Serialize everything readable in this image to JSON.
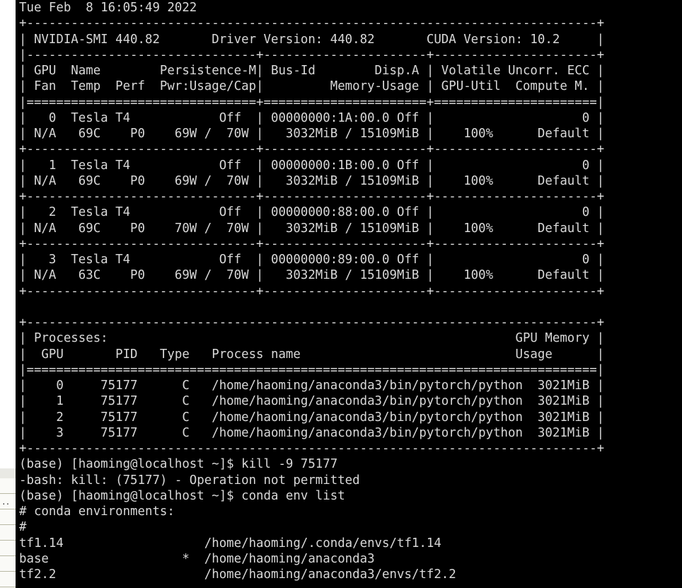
{
  "window": {
    "app": "terminal",
    "background_app": "spreadsheet",
    "bg_cell_text": ".."
  },
  "terminal": {
    "colors": {
      "background": "#000000",
      "foreground": "#d8d8d8",
      "page_background": "#ffffff"
    },
    "timestamp": "Tue Feb  8 16:05:49 2022",
    "nvidia_smi": {
      "version": "440.82",
      "driver_version": "440.82",
      "cuda_version": "10.2",
      "header_labels": {
        "smi_label": "NVIDIA-SMI",
        "driver_label": "Driver Version:",
        "cuda_label": "CUDA Version:"
      },
      "column_headers_line1": [
        "GPU",
        "Name",
        "Persistence-M",
        "Bus-Id",
        "Disp.A",
        "Volatile Uncorr. ECC"
      ],
      "column_headers_line2": [
        "Fan",
        "Temp",
        "Perf",
        "Pwr:Usage/Cap",
        "Memory-Usage",
        "GPU-Util",
        "Compute M."
      ],
      "gpus": [
        {
          "index": "0",
          "name": "Tesla T4",
          "persistence_m": "Off",
          "bus_id": "00000000:1A:00.0",
          "disp_a": "Off",
          "ecc": "0",
          "fan": "N/A",
          "temp": "69C",
          "perf": "P0",
          "pwr_usage": "69W",
          "pwr_cap": "70W",
          "mem_used": "3032MiB",
          "mem_total": "15109MiB",
          "gpu_util": "100%",
          "compute_m": "Default"
        },
        {
          "index": "1",
          "name": "Tesla T4",
          "persistence_m": "Off",
          "bus_id": "00000000:1B:00.0",
          "disp_a": "Off",
          "ecc": "0",
          "fan": "N/A",
          "temp": "69C",
          "perf": "P0",
          "pwr_usage": "69W",
          "pwr_cap": "70W",
          "mem_used": "3032MiB",
          "mem_total": "15109MiB",
          "gpu_util": "100%",
          "compute_m": "Default"
        },
        {
          "index": "2",
          "name": "Tesla T4",
          "persistence_m": "Off",
          "bus_id": "00000000:88:00.0",
          "disp_a": "Off",
          "ecc": "0",
          "fan": "N/A",
          "temp": "69C",
          "perf": "P0",
          "pwr_usage": "70W",
          "pwr_cap": "70W",
          "mem_used": "3032MiB",
          "mem_total": "15109MiB",
          "gpu_util": "100%",
          "compute_m": "Default"
        },
        {
          "index": "3",
          "name": "Tesla T4",
          "persistence_m": "Off",
          "bus_id": "00000000:89:00.0",
          "disp_a": "Off",
          "ecc": "0",
          "fan": "N/A",
          "temp": "63C",
          "perf": "P0",
          "pwr_usage": "69W",
          "pwr_cap": "70W",
          "mem_used": "3032MiB",
          "mem_total": "15109MiB",
          "gpu_util": "100%",
          "compute_m": "Default"
        }
      ],
      "processes_section": {
        "title": "Processes:",
        "column_headers": [
          "GPU",
          "PID",
          "Type",
          "Process name",
          "GPU Memory",
          "Usage"
        ],
        "rows": [
          {
            "gpu": "0",
            "pid": "75177",
            "type": "C",
            "process_name": "/home/haoming/anaconda3/bin/pytorch/python",
            "memory": "3021MiB"
          },
          {
            "gpu": "1",
            "pid": "75177",
            "type": "C",
            "process_name": "/home/haoming/anaconda3/bin/pytorch/python",
            "memory": "3021MiB"
          },
          {
            "gpu": "2",
            "pid": "75177",
            "type": "C",
            "process_name": "/home/haoming/anaconda3/bin/pytorch/python",
            "memory": "3021MiB"
          },
          {
            "gpu": "3",
            "pid": "75177",
            "type": "C",
            "process_name": "/home/haoming/anaconda3/bin/pytorch/python",
            "memory": "3021MiB"
          }
        ]
      }
    },
    "shell": {
      "prompt": "(base) [haoming@localhost ~]$",
      "conda_env": "base",
      "user": "haoming",
      "host": "localhost",
      "cwd": "~",
      "commands": [
        {
          "command": "kill -9 75177",
          "output": [
            "-bash: kill: (75177) - Operation not permitted"
          ]
        },
        {
          "command": "conda env list",
          "output": [
            "# conda environments:",
            "#"
          ]
        }
      ],
      "conda_envs": [
        {
          "name": "tf1.14",
          "active": "",
          "path": "/home/haoming/.conda/envs/tf1.14"
        },
        {
          "name": "base",
          "active": "*",
          "path": "/home/haoming/anaconda3"
        },
        {
          "name": "tf2.2",
          "active": "",
          "path": "/home/haoming/anaconda3/envs/tf2.2"
        }
      ]
    },
    "lines": [
      "Tue Feb  8 16:05:49 2022",
      "+-----------------------------------------------------------------------------+",
      "| NVIDIA-SMI 440.82       Driver Version: 440.82       CUDA Version: 10.2     |",
      "|-------------------------------+----------------------+----------------------+",
      "| GPU  Name        Persistence-M| Bus-Id        Disp.A | Volatile Uncorr. ECC |",
      "| Fan  Temp  Perf  Pwr:Usage/Cap|         Memory-Usage | GPU-Util  Compute M. |",
      "|===============================+======================+======================|",
      "|   0  Tesla T4            Off  | 00000000:1A:00.0 Off |                    0 |",
      "| N/A   69C    P0    69W /  70W |   3032MiB / 15109MiB |    100%      Default |",
      "+-------------------------------+----------------------+----------------------+",
      "|   1  Tesla T4            Off  | 00000000:1B:00.0 Off |                    0 |",
      "| N/A   69C    P0    69W /  70W |   3032MiB / 15109MiB |    100%      Default |",
      "+-------------------------------+----------------------+----------------------+",
      "|   2  Tesla T4            Off  | 00000000:88:00.0 Off |                    0 |",
      "| N/A   69C    P0    70W /  70W |   3032MiB / 15109MiB |    100%      Default |",
      "+-------------------------------+----------------------+----------------------+",
      "|   3  Tesla T4            Off  | 00000000:89:00.0 Off |                    0 |",
      "| N/A   63C    P0    69W /  70W |   3032MiB / 15109MiB |    100%      Default |",
      "+-------------------------------+----------------------+----------------------+",
      "",
      "+-----------------------------------------------------------------------------+",
      "| Processes:                                                       GPU Memory |",
      "|  GPU       PID   Type   Process name                             Usage      |",
      "|=============================================================================|",
      "|    0     75177      C   /home/haoming/anaconda3/bin/pytorch/python  3021MiB |",
      "|    1     75177      C   /home/haoming/anaconda3/bin/pytorch/python  3021MiB |",
      "|    2     75177      C   /home/haoming/anaconda3/bin/pytorch/python  3021MiB |",
      "|    3     75177      C   /home/haoming/anaconda3/bin/pytorch/python  3021MiB |",
      "+-----------------------------------------------------------------------------+",
      "(base) [haoming@localhost ~]$ kill -9 75177",
      "-bash: kill: (75177) - Operation not permitted",
      "(base) [haoming@localhost ~]$ conda env list",
      "# conda environments:",
      "#",
      "tf1.14                   /home/haoming/.conda/envs/tf1.14",
      "base                  *  /home/haoming/anaconda3",
      "tf2.2                    /home/haoming/anaconda3/envs/tf2.2"
    ]
  }
}
